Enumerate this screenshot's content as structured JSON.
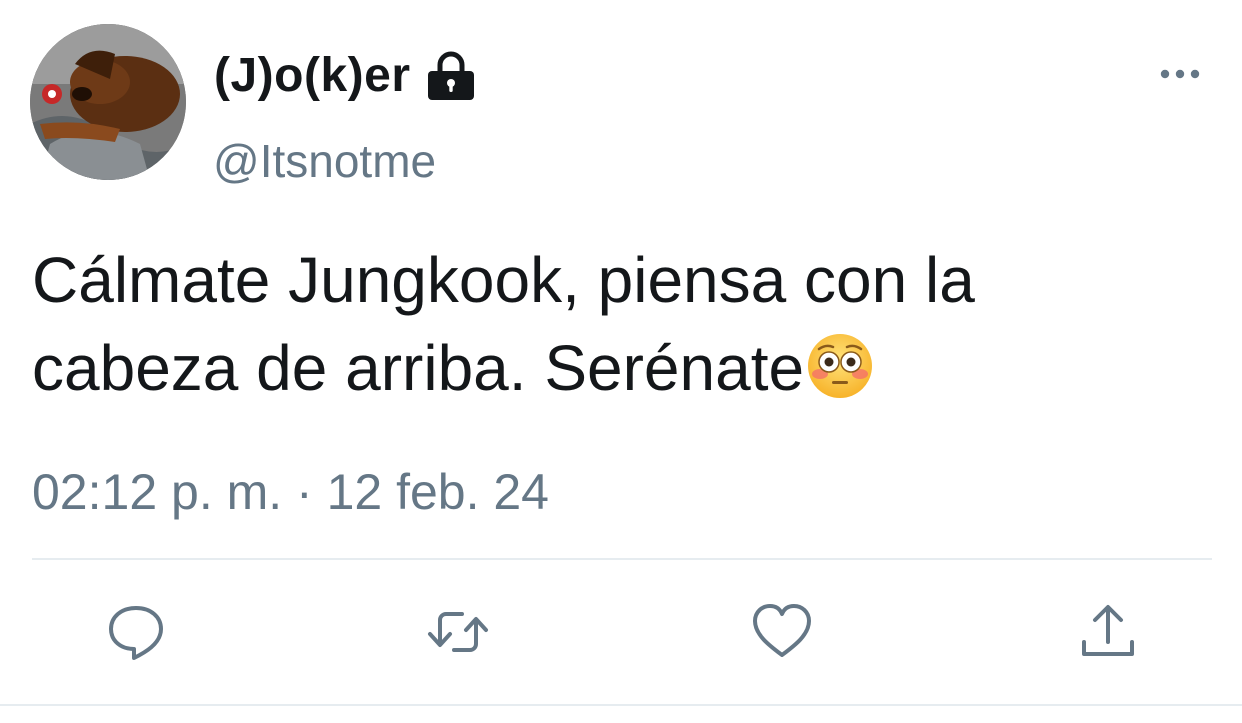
{
  "user": {
    "display_name": "(J)o(k)er",
    "handle": "@Itsnotme",
    "avatar_icon": "dog-photo-avatar",
    "protected_icon": "lock-icon"
  },
  "tweet": {
    "line1": "Cálmate Jungkook, piensa con la",
    "line2": "cabeza de arriba. Serénate",
    "emoji": "😳",
    "timestamp": "02:12 p. m. · 12 feb. 24"
  },
  "actions": [
    {
      "name": "reply",
      "icon": "reply-icon"
    },
    {
      "name": "retweet",
      "icon": "retweet-icon"
    },
    {
      "name": "like",
      "icon": "heart-icon"
    },
    {
      "name": "share",
      "icon": "share-icon"
    }
  ],
  "colors": {
    "text": "#14171a",
    "secondary": "#657786",
    "divider": "#e6ecf0"
  }
}
